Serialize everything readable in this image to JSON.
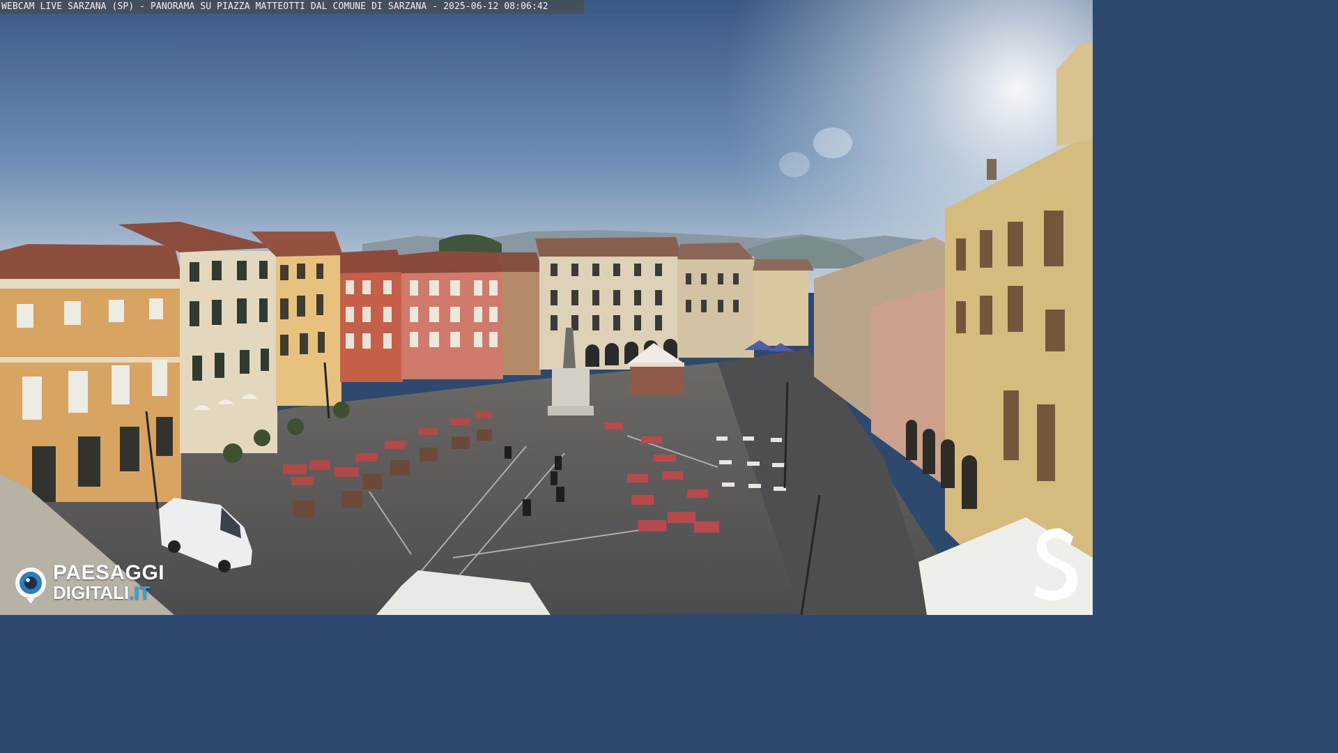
{
  "overlay": {
    "caption": "WEBCAM LIVE SARZANA (SP) - PANORAMA SU PIAZZA MATTEOTTI DAL COMUNE DI SARZANA - 2025-06-12  08:06:42"
  },
  "branding": {
    "watermark_line1": "PAESAGGI",
    "watermark_line2": "DIGITALI",
    "watermark_tld": ".IT",
    "corner_logo_letter": "S"
  },
  "colors": {
    "sky_top": "#3c5a86",
    "sky_mid": "#6f8fb6",
    "sky_horizon": "#c7d3dc",
    "pavement": "#58585a",
    "building_ochre": "#d8a662",
    "building_red": "#c4604c",
    "building_pink": "#cf7a6c",
    "building_cream": "#ddd3b4",
    "building_yellow": "#e6c480",
    "roof": "#8c4f3e",
    "brand_blue": "#27a7dc"
  }
}
